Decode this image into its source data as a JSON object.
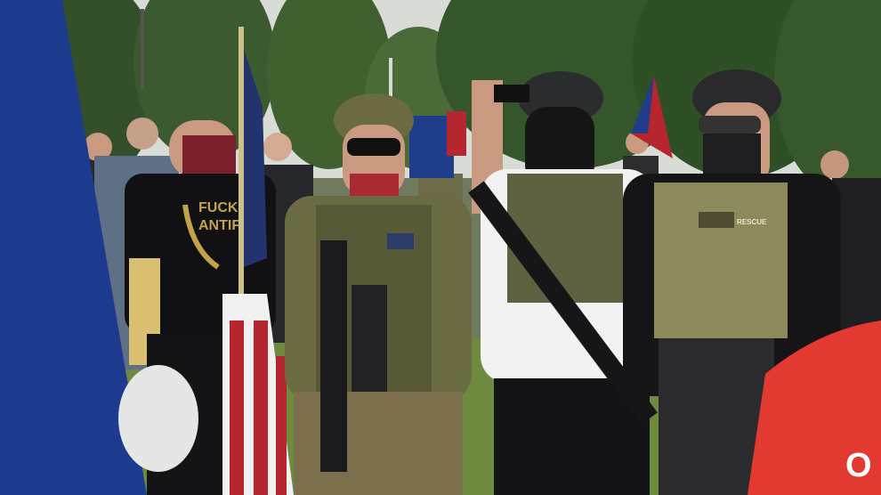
{
  "photo": {
    "shirt_text_line1": "FUCK",
    "shirt_text_line2": "ANTIF",
    "red_shirt_text": "O",
    "patch_text": "RESCUE"
  },
  "colors": {
    "sky": "#d9dcd6",
    "trees": "#3d5a2e",
    "grass": "#6d8a3f",
    "flag_blue": "#1f3d8a",
    "flag_red": "#b5262f",
    "red_shirt": "#e23a30"
  }
}
